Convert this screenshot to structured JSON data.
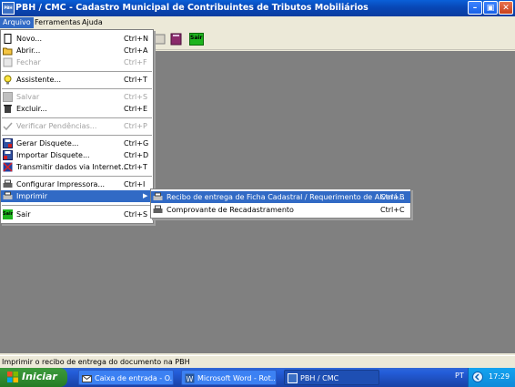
{
  "window": {
    "title": "PBH / CMC - Cadastro Municipal de Contribuintes de Tributos Mobiliários",
    "app_icon": "PBH"
  },
  "menubar": {
    "items": [
      "Arquivo",
      "Ferramentas",
      "Ajuda"
    ]
  },
  "toolbar": {
    "sair_label": "Sair"
  },
  "file_menu": {
    "items": [
      {
        "label": "Novo...",
        "shortcut": "Ctrl+N",
        "icon": "new-document-icon",
        "disabled": false
      },
      {
        "label": "Abrir...",
        "shortcut": "Ctrl+A",
        "icon": "open-folder-icon",
        "disabled": false
      },
      {
        "label": "Fechar",
        "shortcut": "Ctrl+F",
        "icon": "close-document-icon",
        "disabled": true
      },
      {
        "label": "Assistente...",
        "shortcut": "Ctrl+T",
        "icon": "lightbulb-icon",
        "disabled": false
      },
      {
        "label": "Salvar",
        "shortcut": "Ctrl+S",
        "icon": "save-icon",
        "disabled": true
      },
      {
        "label": "Excluir...",
        "shortcut": "Ctrl+E",
        "icon": "trash-icon",
        "disabled": false
      },
      {
        "label": "Verificar Pendências...",
        "shortcut": "Ctrl+P",
        "icon": "checkmark-icon",
        "disabled": true
      },
      {
        "label": "Gerar Disquete...",
        "shortcut": "Ctrl+G",
        "icon": "floppy-export-icon",
        "disabled": false
      },
      {
        "label": "Importar Disquete...",
        "shortcut": "Ctrl+D",
        "icon": "floppy-import-icon",
        "disabled": false
      },
      {
        "label": "Transmitir dados via Internet...",
        "shortcut": "Ctrl+T",
        "icon": "internet-transmit-icon",
        "disabled": false
      },
      {
        "label": "Configurar Impressora...",
        "shortcut": "Ctrl+I",
        "icon": "printer-setup-icon",
        "disabled": false
      },
      {
        "label": "Imprimir",
        "shortcut": "",
        "icon": "printer-icon",
        "disabled": false
      },
      {
        "label": "Sair",
        "shortcut": "Ctrl+S",
        "icon": "exit-icon",
        "disabled": false
      }
    ]
  },
  "print_submenu": {
    "items": [
      {
        "label": "Recibo de entrega de Ficha Cadastral / Requerimento de Alvará...",
        "shortcut": "Ctrl+B"
      },
      {
        "label": "Comprovante de Recadastramento",
        "shortcut": "Ctrl+C"
      }
    ]
  },
  "statusbar": {
    "text": "Imprimir o recibo de entrega do documento na PBH"
  },
  "taskbar": {
    "start_label": "Iniciar",
    "buttons": [
      "Caixa de entrada - O...",
      "Microsoft Word - Rot...",
      "PBH / CMC"
    ],
    "lang": "PT",
    "clock": "17:29"
  },
  "colors": {
    "selection": "#316ac5",
    "titlebar": "#0a5fd8",
    "taskbar": "#245edb",
    "start": "#2f8a2f"
  }
}
